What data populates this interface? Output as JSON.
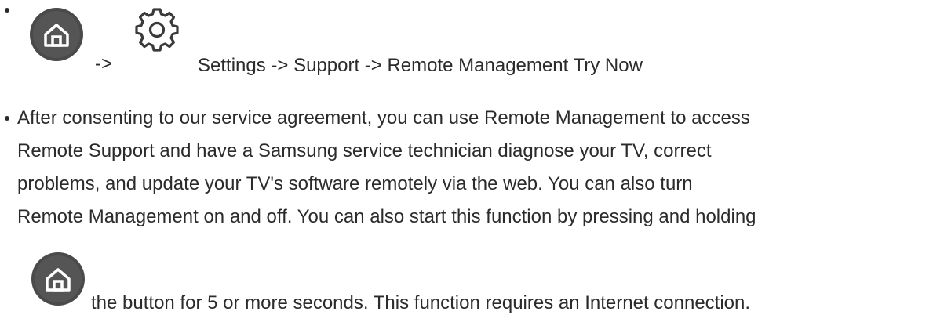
{
  "item1": {
    "arrow_text": "->",
    "path_text": "Settings -> Support -> Remote Management Try Now",
    "home_icon": "home-button-icon",
    "settings_icon": "gear-icon"
  },
  "item2": {
    "lines": [
      "After consenting to our service agreement, you can use Remote Management to access",
      "Remote Support and have a Samsung service technician diagnose your TV, correct",
      "problems, and update your TV's software remotely via the web. You can also turn",
      "Remote Management on and off. You can also start this function by pressing and holding"
    ],
    "last_line": "the button for 5 or more seconds. This function requires an Internet connection.",
    "home_icon": "home-button-icon"
  },
  "colors": {
    "text": "#2b2b2b",
    "icon_circle": "#4a4a4a",
    "icon_glyph": "#ffffff"
  }
}
